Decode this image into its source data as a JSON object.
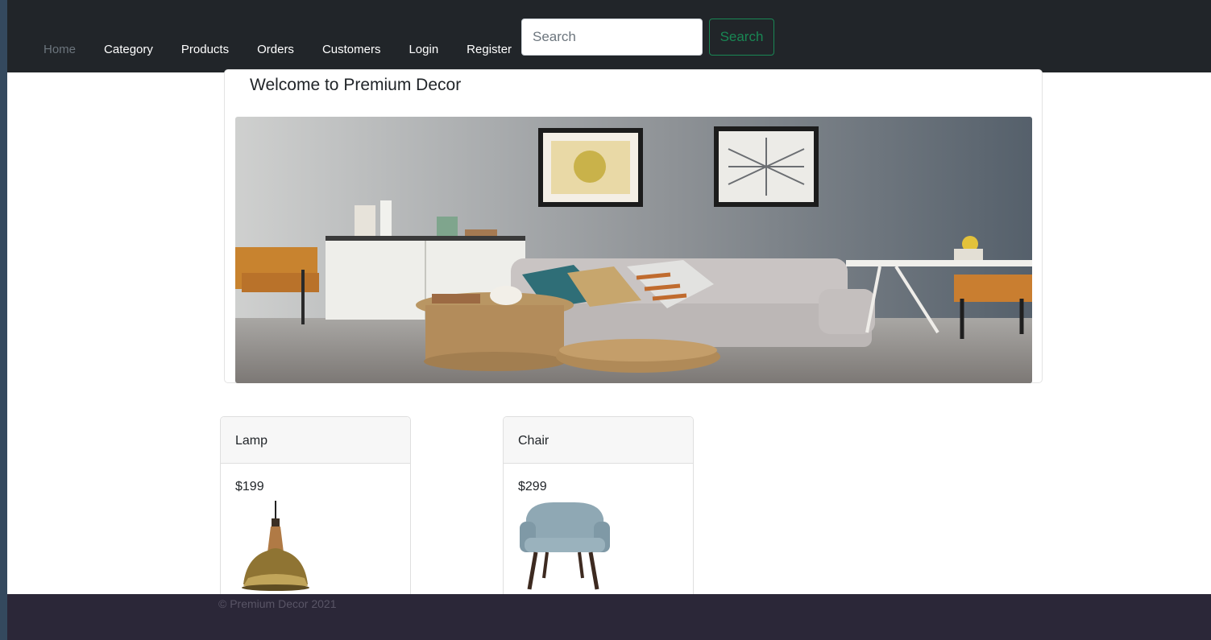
{
  "nav": {
    "items": [
      {
        "label": "Home",
        "active": true
      },
      {
        "label": "Category"
      },
      {
        "label": "Products"
      },
      {
        "label": "Orders"
      },
      {
        "label": "Customers"
      },
      {
        "label": "Login"
      },
      {
        "label": "Register"
      }
    ],
    "search_placeholder": "Search",
    "search_button": "Search"
  },
  "hero": {
    "title": "Welcome to Premium Decor",
    "image": "living-room-banner"
  },
  "products": [
    {
      "name": "Lamp",
      "price": "$199",
      "image": "pendant-lamp"
    },
    {
      "name": "Chair",
      "price": "$299",
      "image": "armchair"
    }
  ],
  "footer": {
    "text": "© Premium Decor 2021"
  },
  "colors": {
    "navbar": "#212529",
    "footer": "#2b2738",
    "search_accent": "#198754",
    "page_bg": "#ffffff"
  }
}
